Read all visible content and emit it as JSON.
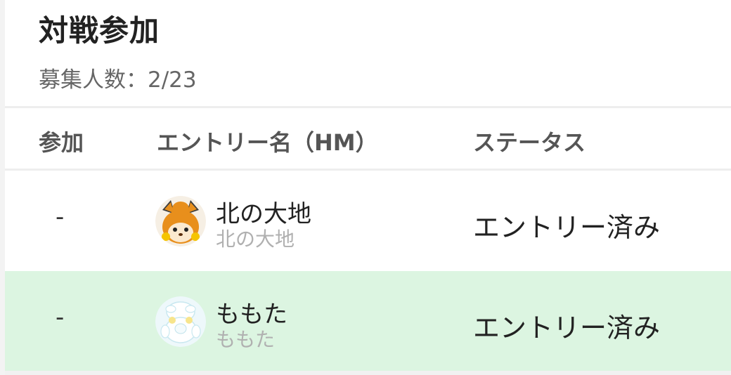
{
  "header": {
    "title": "対戦参加",
    "recruit_count": "募集人数：2/23"
  },
  "table": {
    "columns": {
      "join": "参加",
      "entry_name": "エントリー名（HM）",
      "status": "ステータス"
    },
    "rows": [
      {
        "join": "-",
        "name": "北の大地",
        "sub_name": "北の大地",
        "status": "エントリー済み",
        "avatar_icon": "pawmot-like-avatar-icon",
        "highlighted": false
      },
      {
        "join": "-",
        "name": "ももた",
        "sub_name": "ももた",
        "status": "エントリー済み",
        "avatar_icon": "white-creature-avatar-icon",
        "highlighted": true,
        "highlight_color": "#dcf5e1"
      }
    ]
  }
}
